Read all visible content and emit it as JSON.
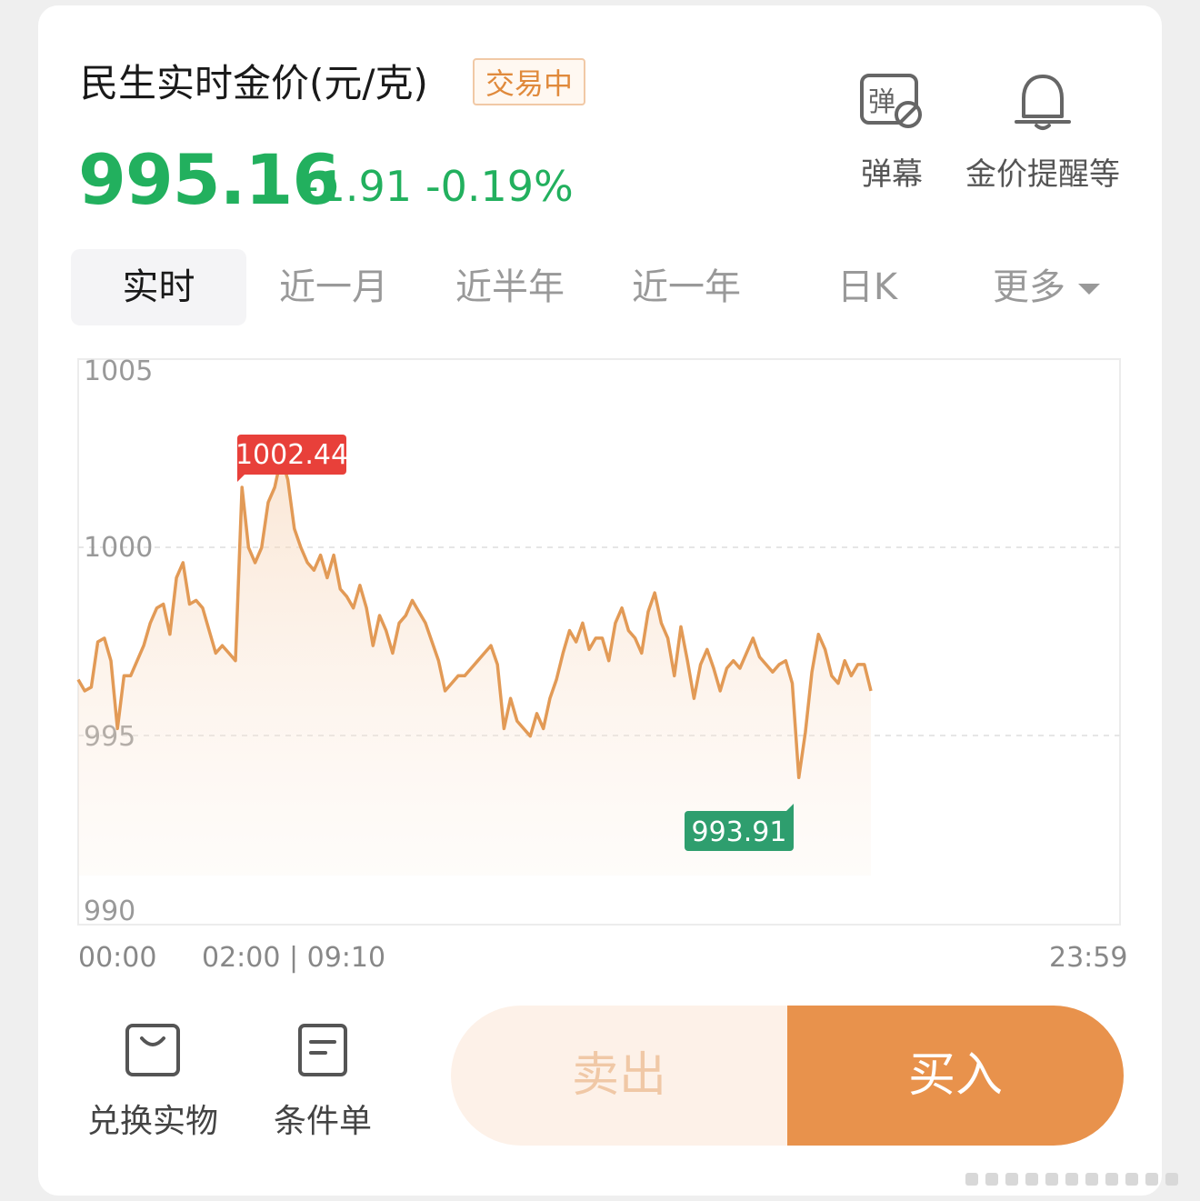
{
  "header": {
    "title": "民生实时金价(元/克)",
    "status_badge": "交易中",
    "price": "995.16",
    "change": "-1.91",
    "change_pct": "-0.19%"
  },
  "tools": [
    {
      "label": "弹幕",
      "icon": "danmaku-off-icon",
      "glyph": "弹"
    },
    {
      "label": "金价提醒等",
      "icon": "bell-icon"
    }
  ],
  "tabs": [
    "实时",
    "近一月",
    "近半年",
    "近一年",
    "日K",
    "更多"
  ],
  "active_tab": "实时",
  "chart_data": {
    "type": "line",
    "ylim": [
      990,
      1005
    ],
    "y_ticks": [
      "1005",
      "1000",
      "995",
      "990"
    ],
    "x_ticks": [
      "00:00",
      "02:00 | 09:10",
      "23:59"
    ],
    "high_label": "1002.44",
    "low_label": "993.91",
    "series": [
      {
        "values": [
          996.5,
          996.2,
          996.3,
          997.5,
          997.6,
          997.0,
          995.2,
          996.6,
          996.6,
          997.0,
          997.4,
          998.0,
          998.4,
          998.5,
          997.7,
          999.2,
          999.6,
          998.5,
          998.6,
          998.4,
          997.8,
          997.2,
          997.4,
          997.2,
          997.0,
          1001.6,
          1000.0,
          999.6,
          1000.0,
          1001.2,
          1001.6,
          1002.4,
          1001.8,
          1000.5,
          1000.0,
          999.6,
          999.4,
          999.8,
          999.2,
          999.8,
          998.9,
          998.7,
          998.4,
          999.0,
          998.4,
          997.4,
          998.2,
          997.8,
          997.2,
          998.0,
          998.2,
          998.6,
          998.3,
          998.0,
          997.5,
          997.0,
          996.2,
          996.4,
          996.6,
          996.6,
          996.8,
          997.0,
          997.2,
          997.4,
          996.9,
          995.2,
          996.0,
          995.4,
          995.2,
          995.0,
          995.6,
          995.2,
          996.0,
          996.5,
          997.2,
          997.8,
          997.5,
          998.0,
          997.3,
          997.6,
          997.6,
          997.0,
          998.0,
          998.4,
          997.8,
          997.6,
          997.2,
          998.3,
          998.8,
          998.0,
          997.6,
          996.6,
          997.9,
          997.0,
          996.0,
          996.9,
          997.3,
          996.8,
          996.2,
          996.8,
          997.0,
          996.8,
          997.2,
          997.6,
          997.1,
          996.9,
          996.7,
          996.9,
          997.0,
          996.4,
          993.9,
          995.1,
          996.7,
          997.7,
          997.3,
          996.6,
          996.4,
          997.0,
          996.6,
          996.9,
          996.9,
          996.2
        ]
      }
    ]
  },
  "actions": [
    {
      "label": "兑换实物",
      "icon": "shopping-bag-icon"
    },
    {
      "label": "条件单",
      "icon": "order-form-icon"
    }
  ],
  "trade": {
    "sell_label": "卖出",
    "buy_label": "买入"
  },
  "colors": {
    "line": "#e29a56",
    "up": "#22b05e",
    "high_tag": "#e8403a",
    "low_tag": "#2e9e6e",
    "buy": "#e8924c",
    "sell_bg": "#fdf1e8"
  }
}
